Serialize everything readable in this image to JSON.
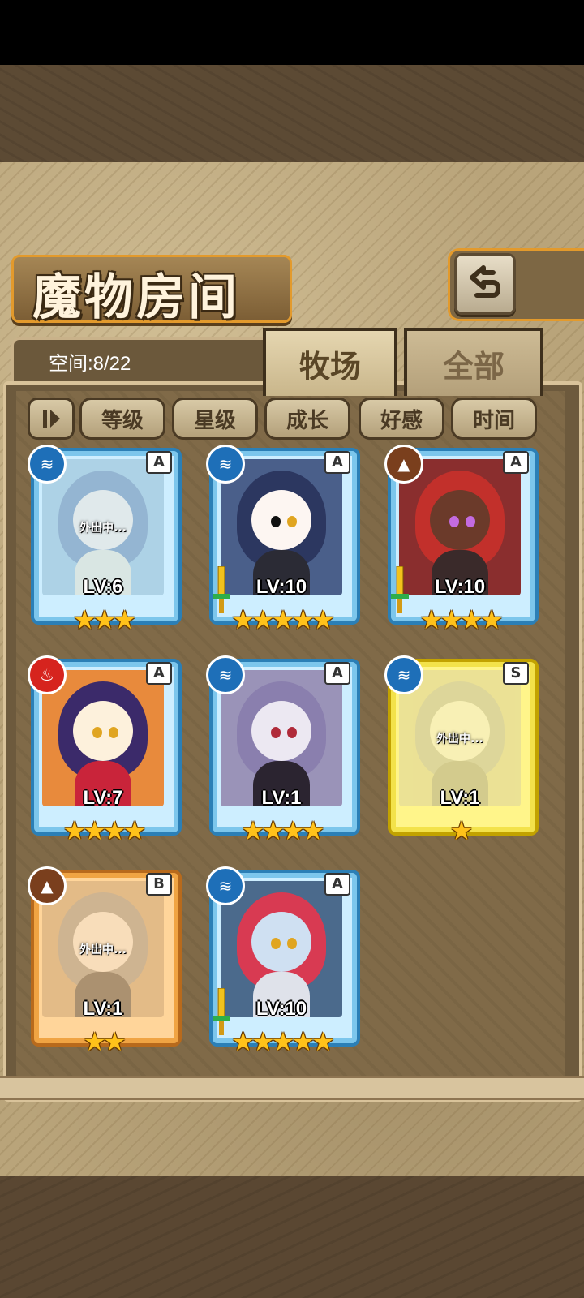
{
  "title": "魔物房间",
  "space": "空间:8/22",
  "tabs": [
    {
      "label": "牧场",
      "active": true
    },
    {
      "label": "全部",
      "active": false
    }
  ],
  "sort_buttons": [
    "等级",
    "星级",
    "成长",
    "好感",
    "时间"
  ],
  "cards": [
    {
      "lv": "LV:6",
      "stars": "★★★",
      "rank": "A",
      "element": "water",
      "away": "外出中...",
      "frame": "blue",
      "equip": false
    },
    {
      "lv": "LV:10",
      "stars": "★★★★★",
      "rank": "A",
      "element": "water",
      "away": "",
      "frame": "blue",
      "equip": true
    },
    {
      "lv": "LV:10",
      "stars": "★★★★",
      "rank": "A",
      "element": "earth",
      "away": "",
      "frame": "blue",
      "equip": true
    },
    {
      "lv": "LV:7",
      "stars": "★★★★",
      "rank": "A",
      "element": "fire",
      "away": "",
      "frame": "blue",
      "equip": false
    },
    {
      "lv": "LV:1",
      "stars": "★★★★",
      "rank": "A",
      "element": "water",
      "away": "",
      "frame": "blue",
      "equip": false
    },
    {
      "lv": "LV:1",
      "stars": "★",
      "rank": "S",
      "element": "water",
      "away": "外出中...",
      "frame": "gold",
      "equip": false
    },
    {
      "lv": "LV:1",
      "stars": "★★",
      "rank": "B",
      "element": "earth",
      "away": "外出中...",
      "frame": "orange",
      "equip": false
    },
    {
      "lv": "LV:10",
      "stars": "★★★★★",
      "rank": "A",
      "element": "water",
      "away": "",
      "frame": "blue",
      "equip": true
    }
  ],
  "colors": {
    "accent": "#e39a2c",
    "water": "#1e6fb8",
    "fire": "#d6241e",
    "earth": "#7a3f1d"
  }
}
